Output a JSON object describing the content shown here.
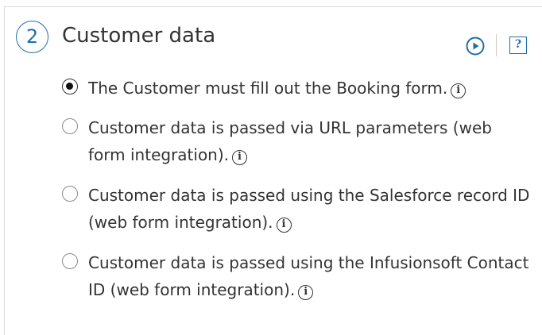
{
  "section": {
    "step_number": "2",
    "title": "Customer data",
    "help_label": "?"
  },
  "options": [
    {
      "label": "The Customer must fill out the Booking form.",
      "selected": true
    },
    {
      "label": "Customer data is passed via URL parameters (web form integration).",
      "selected": false
    },
    {
      "label": "Customer data is passed using the Salesforce record ID (web form integration).",
      "selected": false
    },
    {
      "label": "Customer data is passed using the Infusionsoft Contact ID (web form integration).",
      "selected": false
    }
  ],
  "info_glyph": "i",
  "colors": {
    "accent": "#1f6fa8",
    "text": "#333333",
    "border": "#d9d9d9"
  },
  "icons": [
    "play-icon",
    "help-icon",
    "info-icon"
  ]
}
